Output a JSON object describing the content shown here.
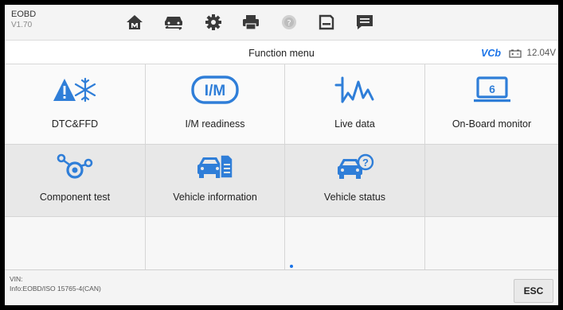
{
  "app": {
    "name": "EOBD",
    "version": "V1.70"
  },
  "toolbar": {
    "buttons": [
      {
        "name": "home",
        "icon": "home-icon"
      },
      {
        "name": "vehicle-swap",
        "icon": "vehicle-swap-icon"
      },
      {
        "name": "settings",
        "icon": "gear-icon"
      },
      {
        "name": "print",
        "icon": "printer-icon"
      },
      {
        "name": "help",
        "icon": "help-icon"
      },
      {
        "name": "save",
        "icon": "save-icon"
      },
      {
        "name": "message",
        "icon": "message-icon"
      }
    ]
  },
  "header": {
    "title": "Function menu",
    "vci_label": "VCI",
    "battery_voltage": "12.04V"
  },
  "menu": {
    "items": [
      {
        "label": "DTC&FFD",
        "icon": "dtc-icon"
      },
      {
        "label": "I/M readiness",
        "icon": "im-icon"
      },
      {
        "label": "Live data",
        "icon": "live-data-icon"
      },
      {
        "label": "On-Board monitor",
        "icon": "onboard-monitor-icon"
      },
      {
        "label": "Component test",
        "icon": "component-test-icon"
      },
      {
        "label": "Vehicle information",
        "icon": "vehicle-info-icon"
      },
      {
        "label": "Vehicle status",
        "icon": "vehicle-status-icon"
      }
    ]
  },
  "footer": {
    "vin": "VIN:",
    "info": "Info:EOBD/ISO 15765-4(CAN)",
    "esc_label": "ESC"
  },
  "colors": {
    "accent": "#1a73e8",
    "icon": "#2f7ed8",
    "dark_icon": "#3a3a3a"
  }
}
